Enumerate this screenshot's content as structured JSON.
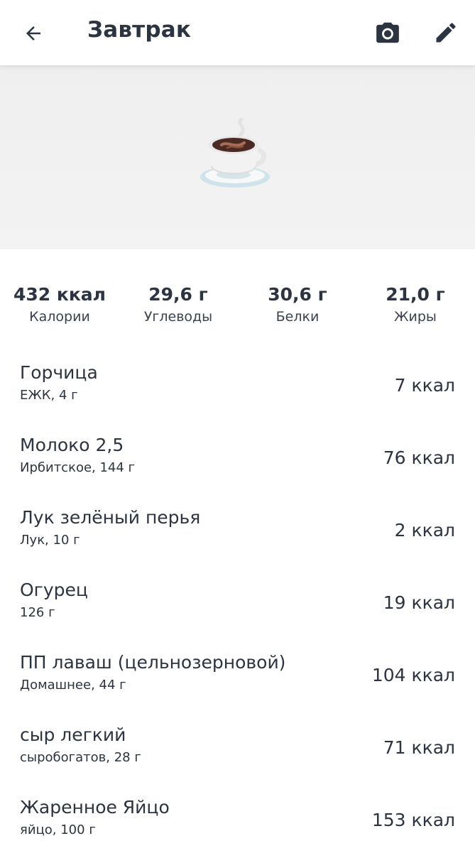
{
  "header": {
    "title": "Завтрак",
    "back_icon": "arrow-left-icon",
    "camera_icon": "camera-icon",
    "edit_icon": "pencil-icon"
  },
  "hero": {
    "icon": "coffee-cup-icon"
  },
  "summary": {
    "calories": {
      "value": "432 ккал",
      "label": "Калории"
    },
    "carbs": {
      "value": "29,6 г",
      "label": "Углеводы"
    },
    "protein": {
      "value": "30,6 г",
      "label": "Белки"
    },
    "fat": {
      "value": "21,0 г",
      "label": "Жиры"
    }
  },
  "items": [
    {
      "name": "Горчица",
      "sub": "ЕЖК, 4 г",
      "kcal": "7 ккал"
    },
    {
      "name": "Молоко 2,5",
      "sub": "Ирбитское, 144 г",
      "kcal": "76 ккал"
    },
    {
      "name": "Лук зелёный перья",
      "sub": "Лук, 10 г",
      "kcal": "2 ккал"
    },
    {
      "name": "Огурец",
      "sub": "126 г",
      "kcal": "19 ккал"
    },
    {
      "name": "ПП лаваш (цельнозерновой)",
      "sub": "Домашнее, 44 г",
      "kcal": "104 ккал"
    },
    {
      "name": "сыр легкий",
      "sub": "сыробогатов, 28 г",
      "kcal": "71 ккал"
    },
    {
      "name": "Жаренное Яйцо",
      "sub": "яйцо, 100 г",
      "kcal": "153 ккал"
    }
  ],
  "colors": {
    "text": "#2b3440",
    "hero_bg": "#efefef"
  }
}
